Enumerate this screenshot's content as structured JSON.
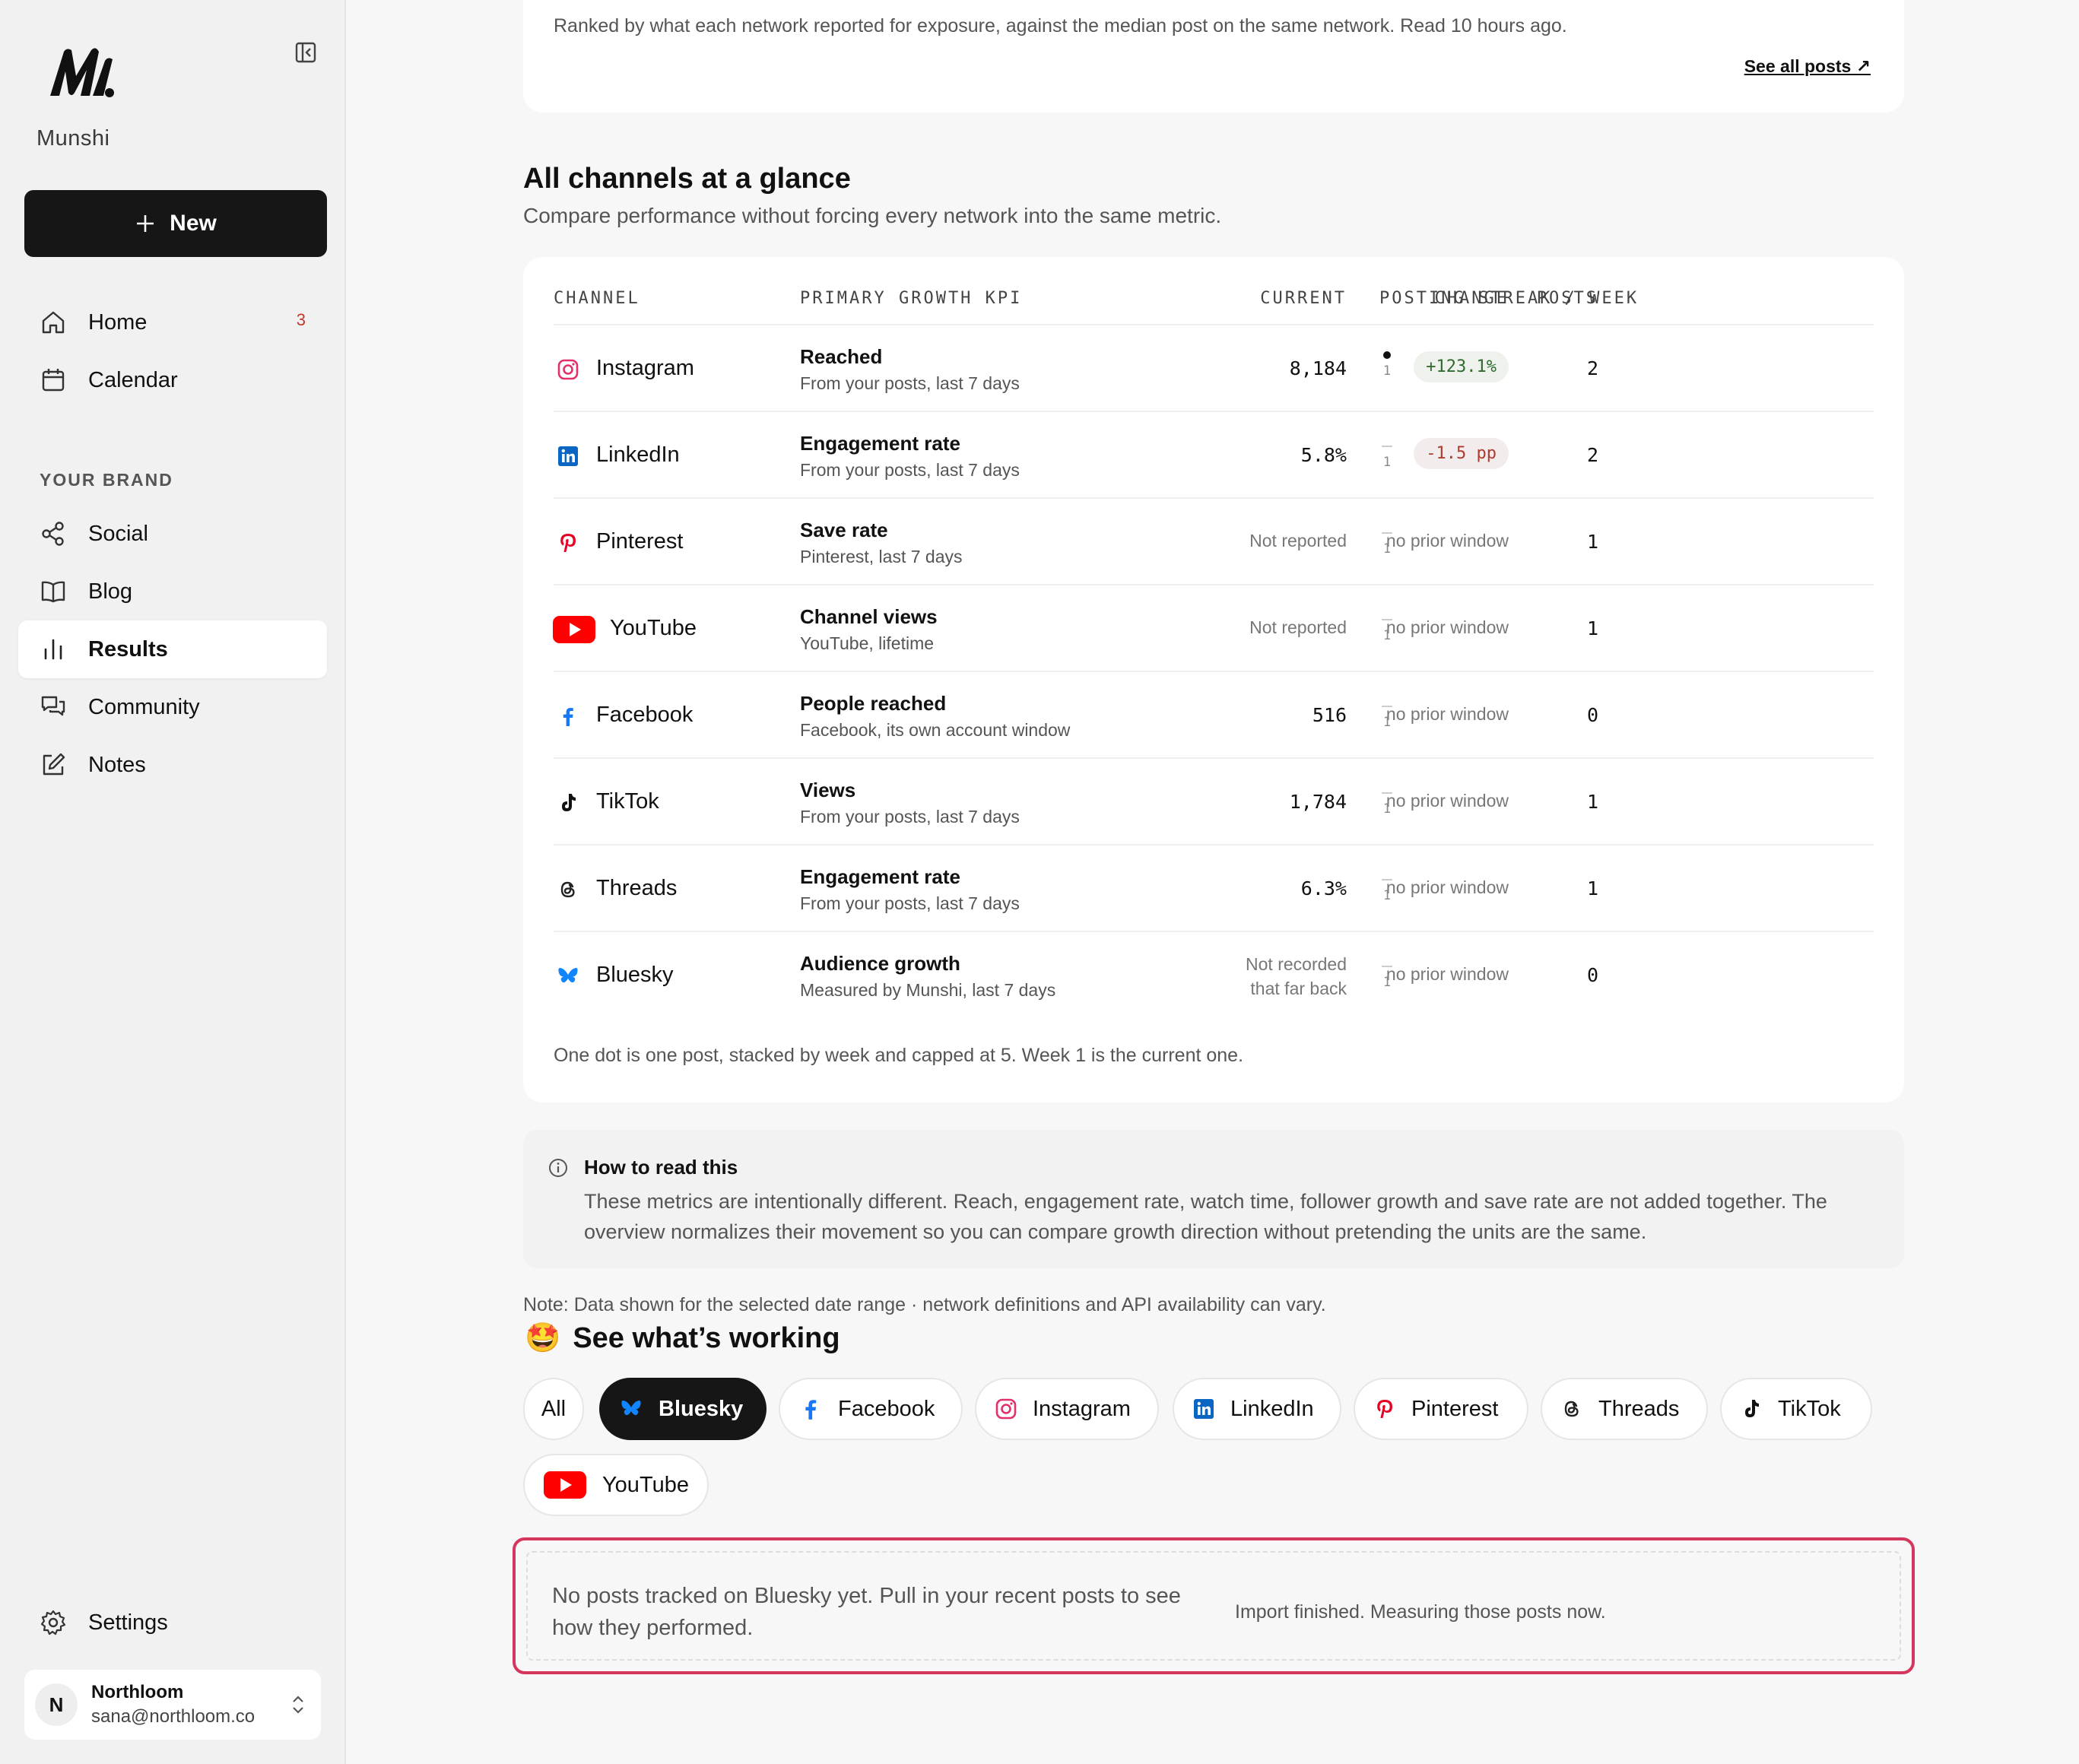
{
  "app": {
    "brand": "Munshi"
  },
  "sidebar": {
    "new_label": "New",
    "section_label": "YOUR BRAND",
    "items": [
      {
        "label": "Home",
        "icon": "home-icon",
        "badge": "3"
      },
      {
        "label": "Calendar",
        "icon": "calendar-icon"
      },
      {
        "label": "Social",
        "icon": "share-icon"
      },
      {
        "label": "Blog",
        "icon": "book-icon"
      },
      {
        "label": "Results",
        "icon": "bar-chart-icon",
        "active": true
      },
      {
        "label": "Community",
        "icon": "chat-icon"
      },
      {
        "label": "Notes",
        "icon": "edit-icon"
      }
    ],
    "settings_label": "Settings",
    "account": {
      "initial": "N",
      "name": "Northloom",
      "email": "sana@northloom.co"
    }
  },
  "top_card": {
    "description": "Ranked by what each network reported for exposure, against the median post on the same network. Read 10 hours ago.",
    "see_all": "See all posts ↗"
  },
  "glance": {
    "title": "All channels at a glance",
    "subtitle": "Compare performance without forcing every network into the same metric.",
    "headers": {
      "channel": "CHANNEL",
      "kpi": "PRIMARY GROWTH KPI",
      "current": "CURRENT",
      "change": "CHANGE",
      "posts": "POSTS",
      "streak": "POSTING STREAK / WEEK"
    },
    "rows": [
      {
        "channel": "Instagram",
        "kpi": "Reached",
        "kpi_sub": "From your posts, last 7 days",
        "current": "8,184",
        "change": "+123.1%",
        "change_type": "pos",
        "posts": "2",
        "streak_week": "1",
        "streak_dots": 1
      },
      {
        "channel": "LinkedIn",
        "kpi": "Engagement rate",
        "kpi_sub": "From your posts, last 7 days",
        "current": "5.8%",
        "change": "-1.5 pp",
        "change_type": "neg",
        "posts": "2",
        "streak_week": "1",
        "streak_dots": 0
      },
      {
        "channel": "Pinterest",
        "kpi": "Save rate",
        "kpi_sub": "Pinterest, last 7 days",
        "current": "Not reported",
        "change": "no prior window",
        "change_type": "none",
        "posts": "1",
        "streak_week": "1",
        "streak_dots": 0
      },
      {
        "channel": "YouTube",
        "kpi": "Channel views",
        "kpi_sub": "YouTube, lifetime",
        "current": "Not reported",
        "change": "no prior window",
        "change_type": "none",
        "posts": "1",
        "streak_week": "1",
        "streak_dots": 0
      },
      {
        "channel": "Facebook",
        "kpi": "People reached",
        "kpi_sub": "Facebook, its own account window",
        "current": "516",
        "change": "no prior window",
        "change_type": "none",
        "posts": "0",
        "streak_week": "1",
        "streak_dots": 0
      },
      {
        "channel": "TikTok",
        "kpi": "Views",
        "kpi_sub": "From your posts, last 7 days",
        "current": "1,784",
        "change": "no prior window",
        "change_type": "none",
        "posts": "1",
        "streak_week": "1",
        "streak_dots": 0
      },
      {
        "channel": "Threads",
        "kpi": "Engagement rate",
        "kpi_sub": "From your posts, last 7 days",
        "current": "6.3%",
        "change": "no prior window",
        "change_type": "none",
        "posts": "1",
        "streak_week": "1",
        "streak_dots": 0
      },
      {
        "channel": "Bluesky",
        "kpi": "Audience growth",
        "kpi_sub": "Measured by Munshi, last 7 days",
        "current_line1": "Not recorded",
        "current_line2": "that far back",
        "change": "no prior window",
        "change_type": "none",
        "posts": "0",
        "streak_week": "1",
        "streak_dots": 0
      }
    ],
    "footnote": "One dot is one post, stacked by week and capped at 5. Week 1 is the current one."
  },
  "how_to_read": {
    "title": "How to read this",
    "body": "These metrics are intentionally different. Reach, engagement rate, watch time, follower growth and save rate are not added together. The overview normalizes their movement so you can compare growth direction without pretending the units are the same."
  },
  "note": "Note: Data shown for the selected date range · network definitions and API availability can vary.",
  "working": {
    "emoji": "🤩",
    "title": "See what’s working",
    "filters": [
      "All",
      "Bluesky",
      "Facebook",
      "Instagram",
      "LinkedIn",
      "Pinterest",
      "Threads",
      "TikTok",
      "YouTube"
    ],
    "active_filter": "Bluesky",
    "empty_text": "No posts tracked on Bluesky yet. Pull in your recent posts to see how they performed.",
    "status": "Import finished. Measuring those posts now."
  },
  "colors": {
    "accent_dark": "#161616",
    "highlight_border": "#d6365d",
    "positive": "#2f6b2f",
    "negative": "#b03a2e",
    "instagram": "#e1306c",
    "linkedin": "#0a66c2",
    "pinterest": "#e60023",
    "youtube": "#ff0000",
    "facebook": "#1877f2",
    "bluesky": "#1185fe"
  }
}
